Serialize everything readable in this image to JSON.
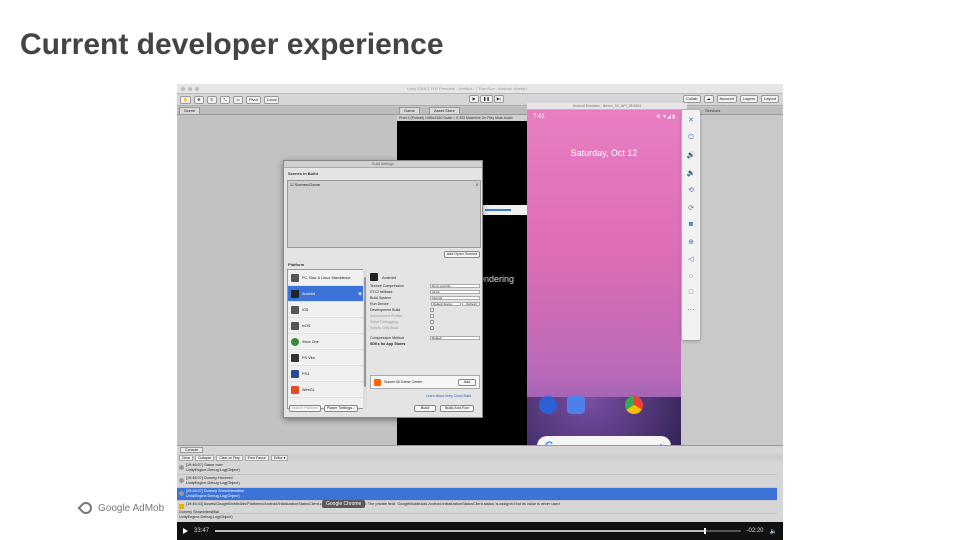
{
  "slide": {
    "title": "Current developer experience",
    "brand": "Google AdMob"
  },
  "unity": {
    "window_title": "Unity 2018.2.11f1 Personal - Untitled - 7 Run Run - Android <Metal>",
    "toolbar": {
      "pivot": "Pivot",
      "local": "Local",
      "collab": "Collab",
      "account": "Account",
      "layers": "Layers",
      "layout": "Layout"
    },
    "tabs": {
      "scene": "Scene",
      "game": "Game",
      "asset_store": "Asset Store",
      "services": "Services"
    },
    "game_toolbar": "Pixel 3 (Portrait) 1080x2160  Scale  ○ 0.333  Maximize On Play  Mute Audio",
    "game_render_text": "endering"
  },
  "build_settings": {
    "title": "Build Settings",
    "scenes_in_build_label": "Scenes in Build",
    "scene_entry": "Scenes/Game",
    "scene_index": "0",
    "add_open_scenes": "Add Open Scenes",
    "platform_label": "Platform",
    "platforms": [
      {
        "name": "PC, Mac & Linux Standalone",
        "icon": "monitor-icon"
      },
      {
        "name": "Android",
        "icon": "android-icon"
      },
      {
        "name": "iOS",
        "icon": "ios-icon"
      },
      {
        "name": "tvOS",
        "icon": "tvos-icon"
      },
      {
        "name": "Xbox One",
        "icon": "xbox-icon"
      },
      {
        "name": "PS Vita",
        "icon": "psvita-icon"
      },
      {
        "name": "PS4",
        "icon": "ps4-icon"
      },
      {
        "name": "WebGL",
        "icon": "html5-icon"
      }
    ],
    "selected_platform": "Android",
    "settings": [
      {
        "label": "Texture Compression",
        "value": "Don't override"
      },
      {
        "label": "ETC2 fallback",
        "value": "32-bit"
      },
      {
        "label": "Build System",
        "value": "Internal"
      },
      {
        "label": "Run Device",
        "value": "Default device"
      },
      {
        "label": "Development Build",
        "value": ""
      },
      {
        "label": "Autoconnect Profiler",
        "value": ""
      },
      {
        "label": "Script Debugging",
        "value": ""
      },
      {
        "label": "Scripts Only Build",
        "value": ""
      }
    ],
    "refresh": "Refresh",
    "compression_label": "Compression Method",
    "compression_value": "Default",
    "sdks_label": "SDKs for App Stores",
    "sdk_name": "Xiaomi Mi Game Center",
    "add": "Add",
    "learn_link": "Learn about Unity Cloud Build",
    "switch_platform": "Switch Platform",
    "player_settings": "Player Settings...",
    "build": "Build",
    "build_and_run": "Build And Run"
  },
  "emulator": {
    "window_title": "Android Emulator - Nexus_5X_API_28:5554",
    "time": "7:41",
    "status_icons": "⚙ ▼◢ ▮",
    "date": "Saturday, Oct 12",
    "search_g": "G",
    "nav": [
      "◀",
      "●",
      "■"
    ],
    "side_controls": [
      "close-icon",
      "minimize-icon",
      "power-icon",
      "volume-up-icon",
      "volume-down-icon",
      "rotate-left-icon",
      "rotate-right-icon",
      "camera-icon",
      "zoom-icon",
      "back-icon",
      "home-icon",
      "overview-icon",
      "more-icon"
    ]
  },
  "console": {
    "tab": "Console",
    "tools": [
      "Clear",
      "Collapse",
      "Clear on Play",
      "Error Pause",
      "Editor ▾"
    ],
    "rows": [
      {
        "text": "[19:46:07] Game over\nUnityEngine.Debug:Log(Object)",
        "selected": false,
        "level": "info"
      },
      {
        "text": "[19:46:07] Dummy Hovered\nUnityEngine.Debug:Log(Object)",
        "selected": false,
        "level": "info"
      },
      {
        "text": "[19:46:07] Dummy ShowInterstitial\nUnityEngine.Debug:Log(Object)",
        "selected": true,
        "level": "info"
      },
      {
        "text": "[19:46:43] Assets/GoogleMobileAds/Platforms/Android/InitializationStatusClient.cs(12,47): warning CS0414: The private field `GoogleMobileAds.Android.InitializationStatusClient.status' is assigned but its value is never used",
        "selected": false,
        "level": "warning"
      }
    ],
    "detail": "Dummy ShowInterstitial\nUnityEngine.Debug:Log(Object)"
  },
  "video": {
    "tooltip": "Google Chrome",
    "elapsed": "33:47",
    "remaining": "-02:20",
    "progress": 0.93
  },
  "colors": {
    "title": "#444444",
    "selection": "#3b73d8"
  }
}
